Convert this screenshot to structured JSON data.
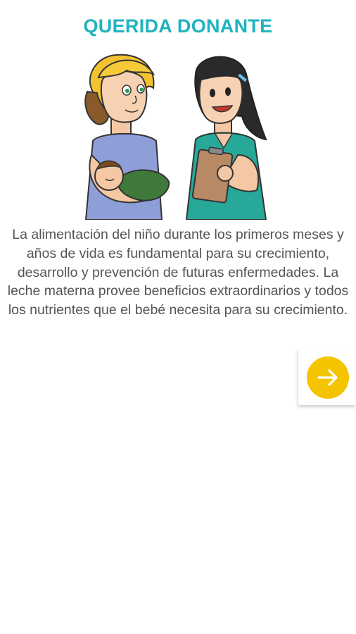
{
  "header": {
    "title": "QUERIDA DONANTE"
  },
  "illustration": {
    "icon": "mother-with-baby-and-nurse-illustration"
  },
  "content": {
    "paragraph": "La alimentación del niño durante los primeros meses y años de vida es fundamental para su crecimiento, desarrollo y prevención de futuras enfermedades. La leche materna provee beneficios extraordinarios y todos los nutrientes que el bebé necesita para su crecimiento."
  },
  "actions": {
    "next_icon": "arrow-right-icon"
  },
  "colors": {
    "title": "#1fb3bf",
    "accent": "#f5c400",
    "text": "#555555"
  }
}
